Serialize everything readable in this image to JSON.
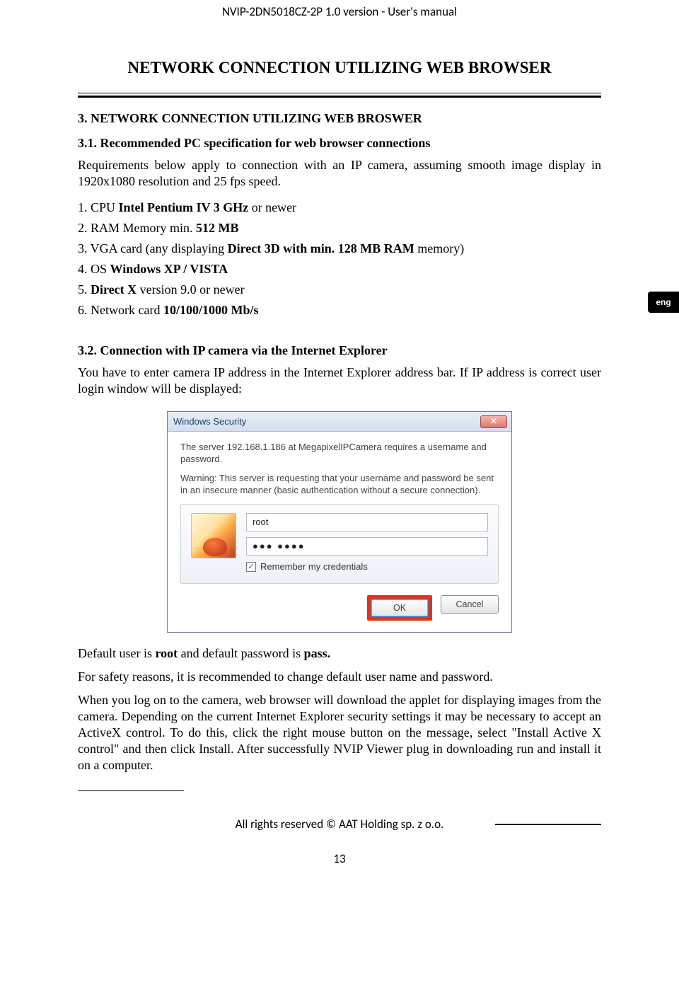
{
  "header": "NVIP-2DN5018CZ-2P 1.0 version - User's manual",
  "page_title": "NETWORK CONNECTION UTILIZING WEB BROWSER",
  "lang_tab": "eng",
  "sec3": {
    "h": "3. NETWORK CONNECTION UTILIZING WEB BROSWER",
    "h31": "3.1. Recommended PC specification for web browser connections",
    "intro": "Requirements below apply to connection with an IP camera, assuming smooth image display in  1920x1080 resolution and 25 fps speed.",
    "items": {
      "i1a": "1. CPU ",
      "i1b": "Intel Pentium IV 3 GHz",
      "i1c": " or newer",
      "i2a": "2. RAM Memory min. ",
      "i2b": "512 MB",
      "i3a": "3. VGA card (any displaying ",
      "i3b": "Direct 3D with min. 128 MB RAM",
      "i3c": " memory)",
      "i4a": "4. OS ",
      "i4b": "Windows XP / VISTA",
      "i5a": "5. ",
      "i5b": "Direct X",
      "i5c": " version 9.0 or newer",
      "i6a": "6. Network card ",
      "i6b": "10/100/1000 Mb/s"
    },
    "h32": "3.2. Connection with IP camera via the Internet Explorer",
    "p32": "You have to enter camera IP address in the Internet Explorer address bar. If IP address is correct user login window will be displayed:"
  },
  "dialog": {
    "title": "Windows Security",
    "line1": "The server 192.168.1.186 at MegapixelIPCamera requires a username and password.",
    "line2": "Warning: This server is requesting that your username and password be sent in an insecure manner (basic authentication without a secure connection).",
    "user": "root",
    "pw": "●●●  ●●●●",
    "remember": "Remember my credentials",
    "ok": "OK",
    "cancel": "Cancel"
  },
  "after": {
    "p1a": "Default user is ",
    "p1b": "root",
    "p1c": " and default password is ",
    "p1d": "pass.",
    "p2": "For safety reasons, it is recommended to change default user name and password.",
    "p3": "When you log on to the camera, web browser will download the applet for displaying images from the camera. Depending on the current Internet Explorer security settings it may be necessary to accept an ActiveX control. To do this, click the right mouse button on the message, select \"Install Active X control\" and then click Install. After successfully NVIP Viewer plug in downloading run and install it on a computer."
  },
  "footer": "All rights reserved © AAT Holding sp. z o.o.",
  "pagenum": "13"
}
